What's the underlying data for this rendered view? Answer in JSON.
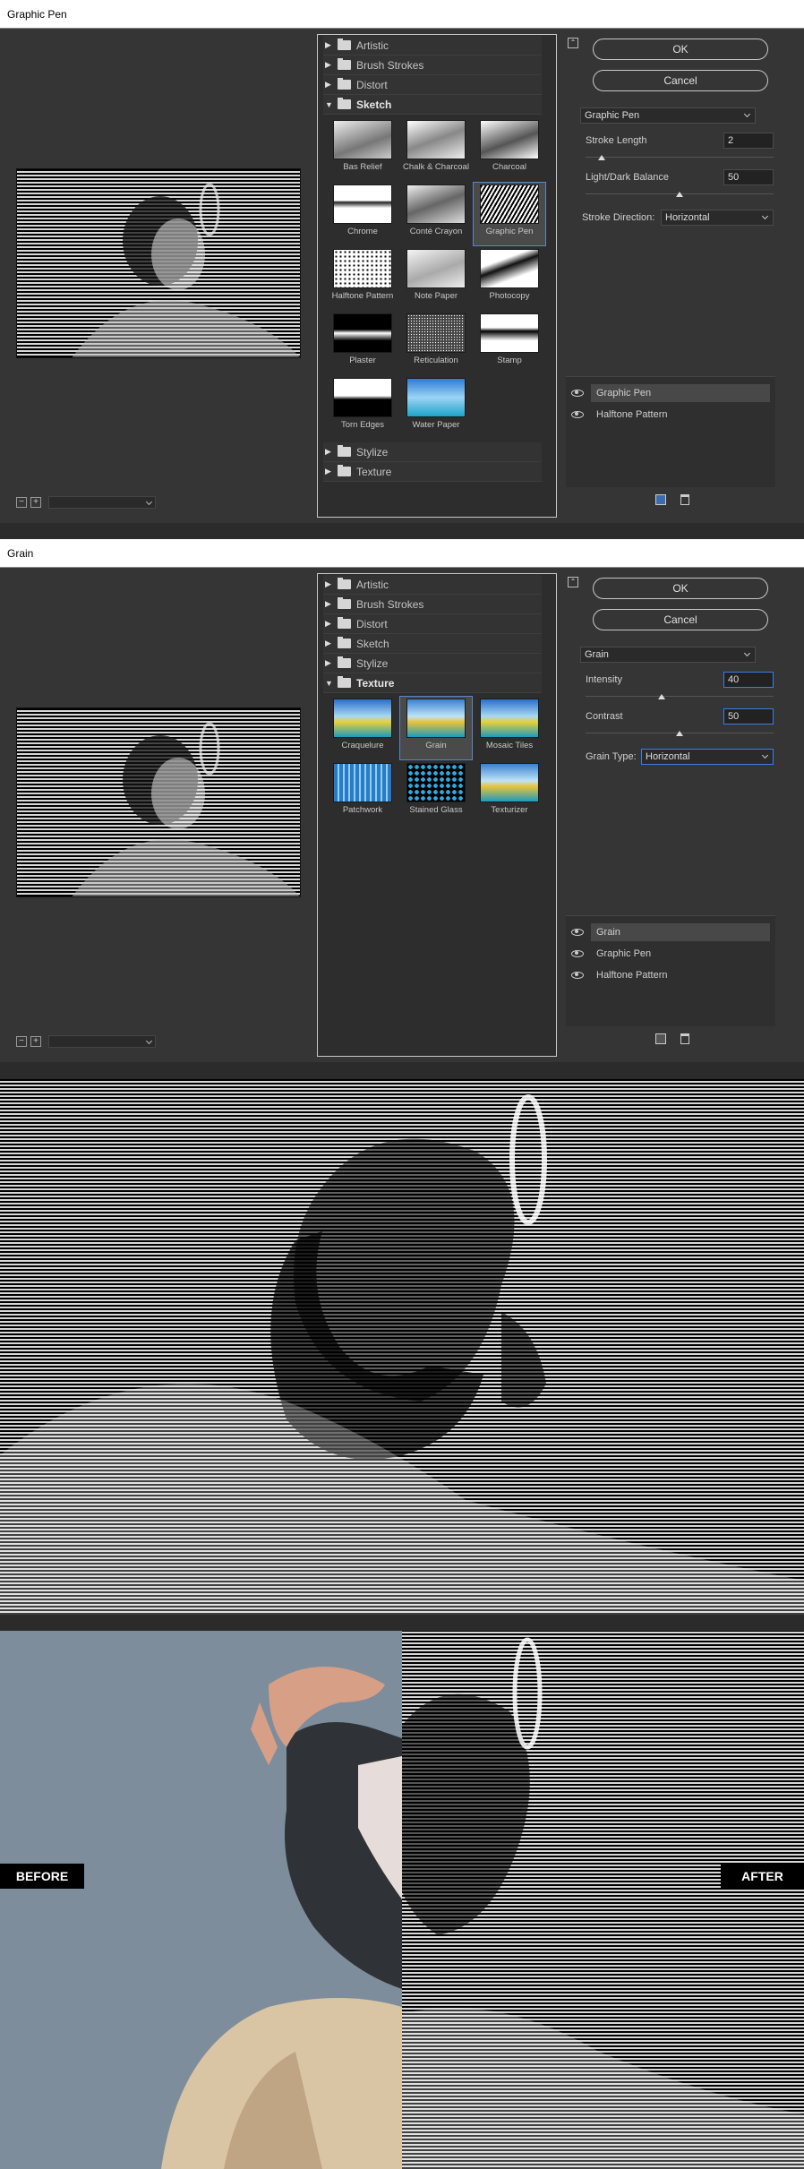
{
  "dialog1": {
    "title": "Graphic Pen",
    "folders_top": [
      "Artistic",
      "Brush Strokes",
      "Distort"
    ],
    "open_folder": "Sketch",
    "thumbs": [
      "Bas Relief",
      "Chalk & Charcoal",
      "Charcoal",
      "Chrome",
      "Conté Crayon",
      "Graphic Pen",
      "Halftone Pattern",
      "Note Paper",
      "Photocopy",
      "Plaster",
      "Reticulation",
      "Stamp",
      "Torn Edges",
      "Water Paper"
    ],
    "selected_thumb": "Graphic Pen",
    "folders_bottom": [
      "Stylize",
      "Texture"
    ],
    "ok": "OK",
    "cancel": "Cancel",
    "filter": "Graphic Pen",
    "stroke_length_label": "Stroke Length",
    "stroke_length": "2",
    "light_dark_label": "Light/Dark Balance",
    "light_dark": "50",
    "stroke_dir_label": "Stroke Direction:",
    "stroke_dir": "Horizontal",
    "layers": [
      "Graphic Pen",
      "Halftone Pattern"
    ]
  },
  "dialog2": {
    "title": "Grain",
    "folders_top": [
      "Artistic",
      "Brush Strokes",
      "Distort",
      "Sketch",
      "Stylize"
    ],
    "open_folder": "Texture",
    "thumbs": [
      "Craquelure",
      "Grain",
      "Mosaic Tiles",
      "Patchwork",
      "Stained Glass",
      "Texturizer"
    ],
    "selected_thumb": "Grain",
    "ok": "OK",
    "cancel": "Cancel",
    "filter": "Grain",
    "intensity_label": "Intensity",
    "intensity": "40",
    "contrast_label": "Contrast",
    "contrast": "50",
    "grain_type_label": "Grain Type:",
    "grain_type": "Horizontal",
    "layers": [
      "Grain",
      "Graphic Pen",
      "Halftone Pattern"
    ]
  },
  "before_label": "BEFORE",
  "after_label": "AFTER",
  "colors": {
    "dialog_bg": "#353535",
    "accent": "#3f7de0",
    "photo_bg": "#7d8d9c"
  }
}
